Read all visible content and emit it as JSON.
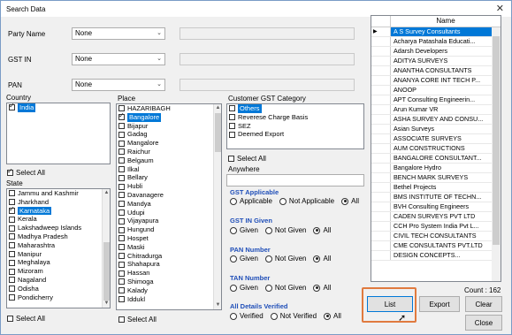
{
  "window": {
    "title": "Search Data"
  },
  "fields": {
    "party_name": {
      "label": "Party Name",
      "value": "None"
    },
    "gst_in": {
      "label": "GST IN",
      "value": "None"
    },
    "pan": {
      "label": "PAN",
      "value": "None"
    }
  },
  "country": {
    "label": "Country",
    "items": [
      {
        "label": "India",
        "checked": true,
        "selected": true
      }
    ],
    "select_all": "Select All"
  },
  "state": {
    "label": "State",
    "items": [
      {
        "label": "Jammu and Kashmir",
        "checked": false
      },
      {
        "label": "Jharkhand",
        "checked": false
      },
      {
        "label": "Karnataka",
        "checked": true,
        "selected": true
      },
      {
        "label": "Kerala",
        "checked": false
      },
      {
        "label": "Lakshadweep Islands",
        "checked": false
      },
      {
        "label": "Madhya Pradesh",
        "checked": false
      },
      {
        "label": "Maharashtra",
        "checked": false
      },
      {
        "label": "Manipur",
        "checked": false
      },
      {
        "label": "Meghalaya",
        "checked": false
      },
      {
        "label": "Mizoram",
        "checked": false
      },
      {
        "label": "Nagaland",
        "checked": false
      },
      {
        "label": "Odisha",
        "checked": false
      },
      {
        "label": "Pondicherry",
        "checked": false
      }
    ],
    "select_all": "Select All"
  },
  "place": {
    "label": "Place",
    "items": [
      {
        "label": "HAZARIBAGH",
        "checked": false
      },
      {
        "label": "Bangalore",
        "checked": true,
        "selected": true
      },
      {
        "label": "Bijapur",
        "checked": false
      },
      {
        "label": "Gadag",
        "checked": false
      },
      {
        "label": "Mangalore",
        "checked": false
      },
      {
        "label": "Raichur",
        "checked": false
      },
      {
        "label": "Belgaum",
        "checked": false
      },
      {
        "label": "Ilkal",
        "checked": false
      },
      {
        "label": "Bellary",
        "checked": false
      },
      {
        "label": "Hubli",
        "checked": false
      },
      {
        "label": "Davanagere",
        "checked": false
      },
      {
        "label": "Mandya",
        "checked": false
      },
      {
        "label": "Udupi",
        "checked": false
      },
      {
        "label": "Vijayapura",
        "checked": false
      },
      {
        "label": "Hungund",
        "checked": false
      },
      {
        "label": "Hospet",
        "checked": false
      },
      {
        "label": "Maski",
        "checked": false
      },
      {
        "label": "Chitradurga",
        "checked": false
      },
      {
        "label": "Shahapura",
        "checked": false
      },
      {
        "label": "Hassan",
        "checked": false
      },
      {
        "label": "Shimoga",
        "checked": false
      },
      {
        "label": "Kalady",
        "checked": false
      },
      {
        "label": "Iddukl",
        "checked": false
      }
    ],
    "select_all": "Select All"
  },
  "customer_gst_category": {
    "label": "Customer GST Category",
    "items": [
      {
        "label": "Others",
        "checked": false,
        "selected": true
      },
      {
        "label": "Reverese Charge Basis",
        "checked": false
      },
      {
        "label": "SEZ",
        "checked": false
      },
      {
        "label": "Deemed Export",
        "checked": false
      }
    ],
    "select_all": "Select All"
  },
  "anywhere": {
    "label": "Anywhere",
    "value": ""
  },
  "gst_applicable": {
    "title": "GST Applicable",
    "options": [
      "Applicable",
      "Not Applicable",
      "All"
    ],
    "selected": "All"
  },
  "gst_in_given": {
    "title": "GST IN Given",
    "options": [
      "Given",
      "Not Given",
      "All"
    ],
    "selected": "All"
  },
  "pan_number": {
    "title": "PAN Number",
    "options": [
      "Given",
      "Not Given",
      "All"
    ],
    "selected": "All"
  },
  "tan_number": {
    "title": "TAN Number",
    "options": [
      "Given",
      "Not Given",
      "All"
    ],
    "selected": "All"
  },
  "all_details_verified": {
    "title": "All Details Verified",
    "options": [
      "Verified",
      "Not Verified",
      "All"
    ],
    "selected": "All"
  },
  "grid": {
    "header": "Name",
    "rows": [
      "A S Survey Consultants",
      "Acharya Patashala Educati...",
      "Adarsh Developers",
      "ADITYA SURVEYS",
      "ANANTHA CONSULTANTS",
      "ANANYA CORE INT TECH P...",
      "ANOOP",
      "APT Consulting Engineerin...",
      "Arun Kumar VR",
      "ASHA SURVEY AND CONSU...",
      "Asian Surveys",
      "ASSOCIATE SURVEYS",
      "AUM CONSTRUCTIONS",
      "BANGALORE CONSULTANT...",
      "Bangalore Hydro",
      "BENCH MARK SURVEYS",
      "Bethel Projects",
      "BMS INSTITUTE OF TECHN...",
      "BVH Consulting Engineers",
      "CADEN SURVEYS PVT LTD",
      "CCH Pro System India Pvt L...",
      "CIVIL TECH CONSULTANTS",
      "CME CONSULTANTS PVT.LTD",
      "DESIGN CONCEPTS..."
    ],
    "count": "Count : 162"
  },
  "buttons": {
    "list": "List",
    "export": "Export",
    "clear": "Clear",
    "close": "Close"
  }
}
